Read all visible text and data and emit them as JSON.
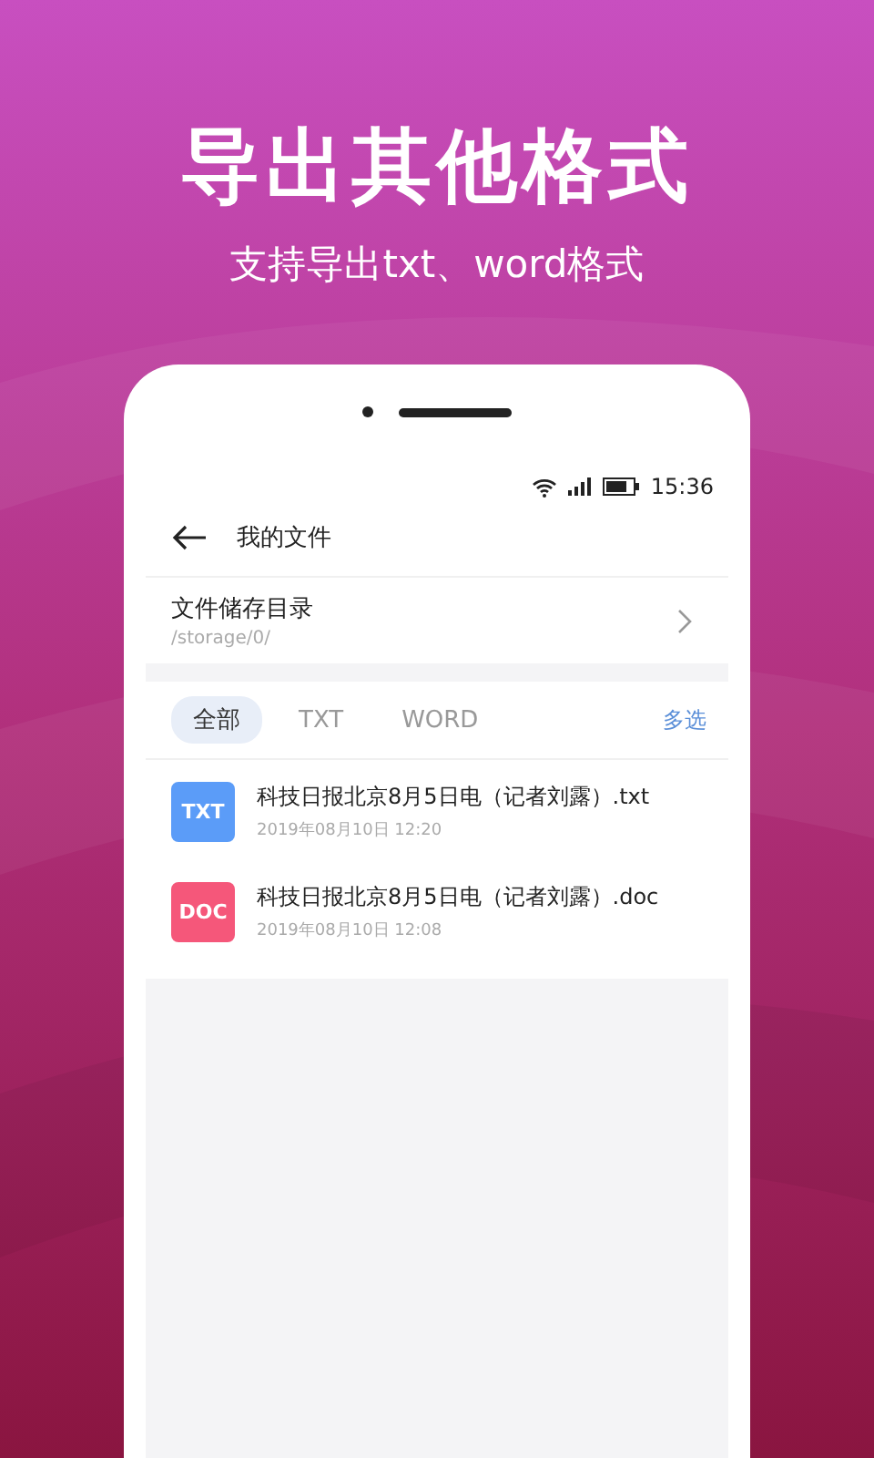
{
  "headline": "导出其他格式",
  "subheadline": "支持导出txt、word格式",
  "status_bar": {
    "time": "15:36"
  },
  "app_bar": {
    "title": "我的文件"
  },
  "storage": {
    "label": "文件储存目录",
    "path": "/storage/0/"
  },
  "tabs": [
    {
      "label": "全部",
      "selected": true
    },
    {
      "label": "TXT",
      "selected": false
    },
    {
      "label": "WORD",
      "selected": false
    }
  ],
  "multi_select": "多选",
  "files": [
    {
      "badge": "TXT",
      "color": "#5b9cf8",
      "name": "科技日报北京8月5日电（记者刘露）.txt",
      "date": "2019年08月10日 12:20"
    },
    {
      "badge": "DOC",
      "color": "#f5577a",
      "name": "科技日报北京8月5日电（记者刘露）.doc",
      "date": "2019年08月10日 12:08"
    }
  ]
}
